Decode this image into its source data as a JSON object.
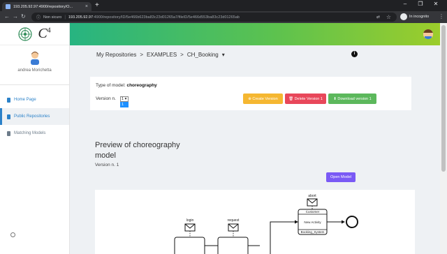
{
  "browser": {
    "tab_title": "193.205.92.97:4900/repository/O...",
    "tab_close": "×",
    "new_tab": "+",
    "not_secure": "Non sicuro",
    "url_host": "193.205.92.97",
    "url_path": ":4900/repository/ID/5e466b623ba83c23d01265a7/fileID/5e466d553ba83c23d01265ab",
    "incognito_label": "In incognito",
    "icons": [
      "back-icon",
      "forward-icon",
      "reload-icon",
      "info-icon",
      "translate-icon",
      "star-icon",
      "incognito-icon",
      "menu-icon"
    ]
  },
  "sidebar": {
    "logo_text": "C",
    "logo_sup": "4",
    "user_name": "andrea Morichetta",
    "items": [
      {
        "label": "Home Page",
        "state": "link"
      },
      {
        "label": "Public Repositories",
        "state": "active"
      },
      {
        "label": "Matching Models",
        "state": "muted"
      }
    ]
  },
  "breadcrumb": {
    "items": [
      "My Repositories",
      ">",
      "EXAMPLES",
      ">",
      "CH_Booking",
      "▾"
    ]
  },
  "model": {
    "type_label": "Type of model:",
    "type_value": "choreography",
    "version_label": "Version n.",
    "version_selected": "1 ▾",
    "version_options": [
      "1"
    ]
  },
  "buttons": {
    "create": "⊕ Create Version",
    "delete": "🗑 Delete Version 1",
    "download": "⬇ Download version 1",
    "open_model": "Open Model"
  },
  "preview": {
    "title": "Preview of choreography model",
    "version_text": "Version n. 1"
  },
  "diagram": {
    "messages": [
      "abort",
      "login",
      "request"
    ],
    "task": {
      "top_participant": "Customer",
      "name": "New Activity",
      "bottom_participant": "Booking_System"
    }
  },
  "colors": {
    "header_gradient": [
      "#27b481",
      "#9ccd2b"
    ],
    "create_button": "#f5b731",
    "delete_button": "#e8475a",
    "download_button": "#5cb85c",
    "open_model_button": "#7a5af5",
    "link": "#2c82c9"
  }
}
